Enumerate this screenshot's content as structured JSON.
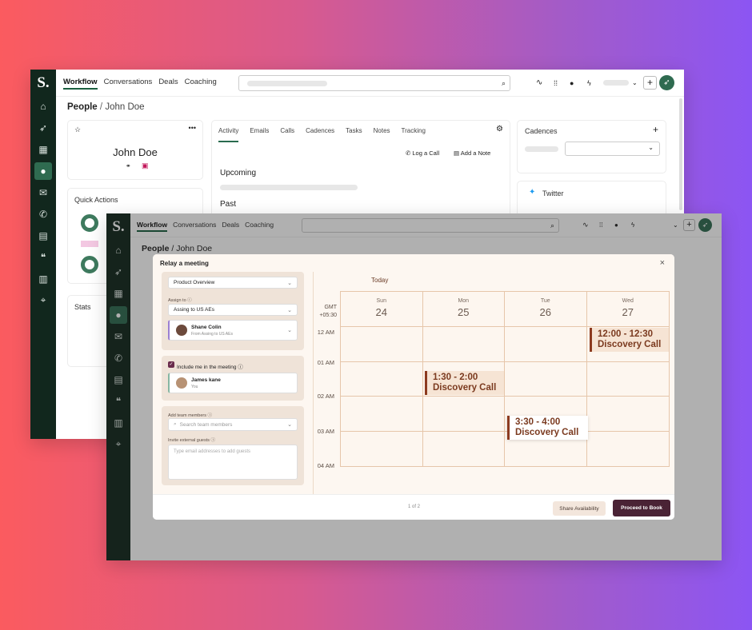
{
  "nav": {
    "workflow": "Workflow",
    "conversations": "Conversations",
    "deals": "Deals",
    "coaching": "Coaching"
  },
  "logo": "S.",
  "back": {
    "breadcrumb_root": "People",
    "breadcrumb_sep": "/",
    "breadcrumb_name": "John Doe",
    "contact_name": "John Doe",
    "quick_actions": "Quick Actions",
    "stats": "Stats",
    "tabs": [
      "Activity",
      "Emails",
      "Calls",
      "Cadences",
      "Tasks",
      "Notes",
      "Tracking"
    ],
    "log_call": "Log a Call",
    "add_note": "Add a Note",
    "upcoming": "Upcoming",
    "past": "Past",
    "cadences": "Cadences",
    "twitter": "Twitter",
    "plus": "+"
  },
  "front": {
    "breadcrumb_root": "People",
    "breadcrumb_sep": "/",
    "breadcrumb_name": "John Doe",
    "modal": {
      "title": "Relay a meeting",
      "close": "×",
      "meeting_type": "Product Overview",
      "assign_label": "Assign to",
      "assign_value": "Assing to US AEs",
      "assignee_name": "Shane Colin",
      "assignee_sub": "From Assing to US AEs",
      "include_label": "Include me in the meeting",
      "me_name": "James kane",
      "me_sub": "You",
      "team_label": "Add team members",
      "team_placeholder": "Search team members",
      "guests_label": "Invite external guests",
      "guests_placeholder": "Type email addresses to add guests",
      "today": "Today",
      "tz": "GMT +05:30",
      "days": [
        {
          "name": "Sun",
          "num": "24"
        },
        {
          "name": "Mon",
          "num": "25"
        },
        {
          "name": "Tue",
          "num": "26"
        },
        {
          "name": "Wed",
          "num": "27"
        }
      ],
      "hours": [
        "12 AM",
        "01 AM",
        "02 AM",
        "03 AM",
        "04 AM"
      ],
      "events": [
        {
          "time": "12:00 - 12:30",
          "title": "Discovery Call"
        },
        {
          "time": "1:30 - 2:00",
          "title": "Discovery Call"
        },
        {
          "time": "3:30 - 4:00",
          "title": "Discovery Call"
        }
      ],
      "page": "1 of 2",
      "share": "Share Availability",
      "proceed": "Proceed to Book"
    }
  },
  "colors": {
    "sidebar": "#11271d",
    "accent": "#2f6b50",
    "event": "#8c3a1f",
    "primary_btn": "#4a2335"
  }
}
